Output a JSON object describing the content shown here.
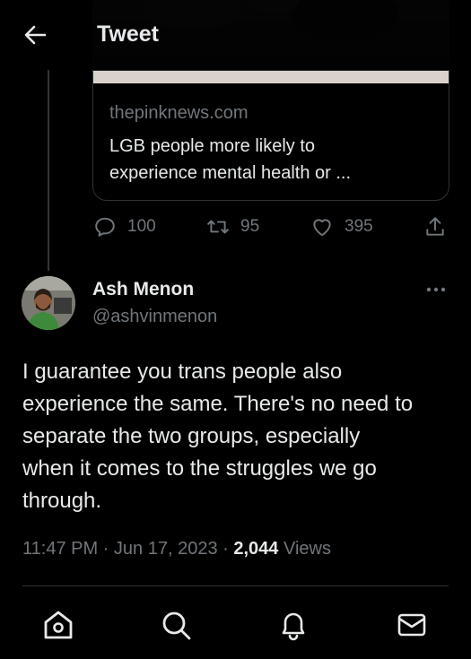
{
  "header": {
    "title": "Tweet"
  },
  "card": {
    "domain": "thepinknews.com",
    "title_line1": "LGB people more likely to",
    "title_line2": "experience mental health or ..."
  },
  "actions": {
    "replies": "100",
    "retweets": "95",
    "likes": "395"
  },
  "author": {
    "name": "Ash Menon",
    "handle": "@ashvinmenon"
  },
  "tweet": {
    "line1": "I guarantee you trans people also",
    "line2": "experience the same. There's no need to",
    "line3": "separate the two groups, especially",
    "line4": "when it comes to the struggles we go",
    "line5": "through."
  },
  "meta": {
    "time": "11:47 PM",
    "sep1": " · ",
    "date": "Jun 17, 2023",
    "sep2": " · ",
    "views_count": "2,044",
    "views_label": " Views"
  },
  "colors": {
    "background": "#000000",
    "text": "#e7e9ea",
    "secondary": "#71767b",
    "border": "#2f3336"
  },
  "icons": {
    "back": "arrow-left-icon",
    "reply": "speech-bubble-icon",
    "retweet": "retweet-icon",
    "like": "heart-icon",
    "share": "share-icon",
    "more": "more-dots-icon",
    "home": "home-icon",
    "search": "search-icon",
    "notifications": "bell-icon",
    "messages": "envelope-icon"
  }
}
